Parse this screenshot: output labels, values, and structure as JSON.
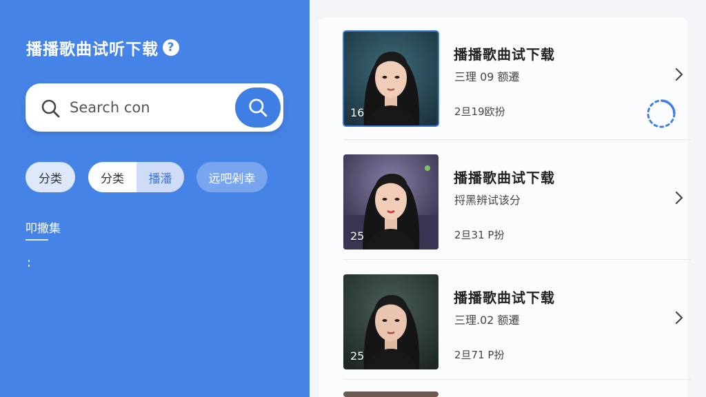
{
  "app": {
    "title": "播播歌曲试听下载",
    "help_label": "?"
  },
  "search": {
    "placeholder": "Search con"
  },
  "chips": {
    "chip1": "分类",
    "chip2_a": "分类",
    "chip2_b": "播潘",
    "chip3": "远吧剁幸"
  },
  "section": {
    "title": "叩撒集"
  },
  "songs": [
    {
      "title": "播播歌曲试下载",
      "sub": "三理 09 额遷",
      "time": "2旦19欧扮",
      "thumb_num": "16"
    },
    {
      "title": "播播歌曲试下载",
      "sub": "捋黑辨试该分",
      "time": "2旦31 P扮",
      "thumb_num": "25"
    },
    {
      "title": "播播歌曲试下载",
      "sub": "三理.02 额遷",
      "time": "2旦71 P扮",
      "thumb_num": "25"
    }
  ],
  "colors": {
    "accent": "#4583e6",
    "button": "#3f7fe3",
    "background": "#f3f5f8"
  },
  "icons": {
    "help": "question-circle-icon",
    "search": "magnifier-icon",
    "next": "chevron-right-icon",
    "loading": "spinner-icon"
  }
}
